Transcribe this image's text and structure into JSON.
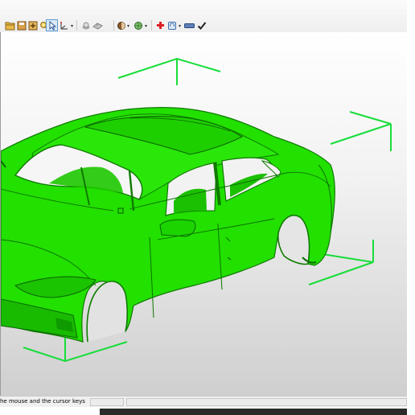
{
  "toolbar": {
    "icons": [
      "open-folder-icon",
      "save-icon",
      "export-icon",
      "zoom-icon",
      "select-pointer-icon",
      "axis-tool-icon",
      "mesh-view-icon",
      "shading-icon",
      "texture-icon",
      "globe-view-icon",
      "add-icon",
      "rotate-view-icon",
      "bar-tool-icon",
      "check-icon"
    ],
    "colors": {
      "add": "#dd1f26",
      "check": "#222222",
      "active_highlight": "#5b9bd5"
    }
  },
  "viewport": {
    "background_top": "#ffffff",
    "background_bottom": "#cfcfcf",
    "model_color": "#22e000",
    "model_shadow": "#0f9a00",
    "bounding_box_color": "#18dd3a"
  },
  "statusbar": {
    "text": "he mouse and the cursor keys"
  }
}
